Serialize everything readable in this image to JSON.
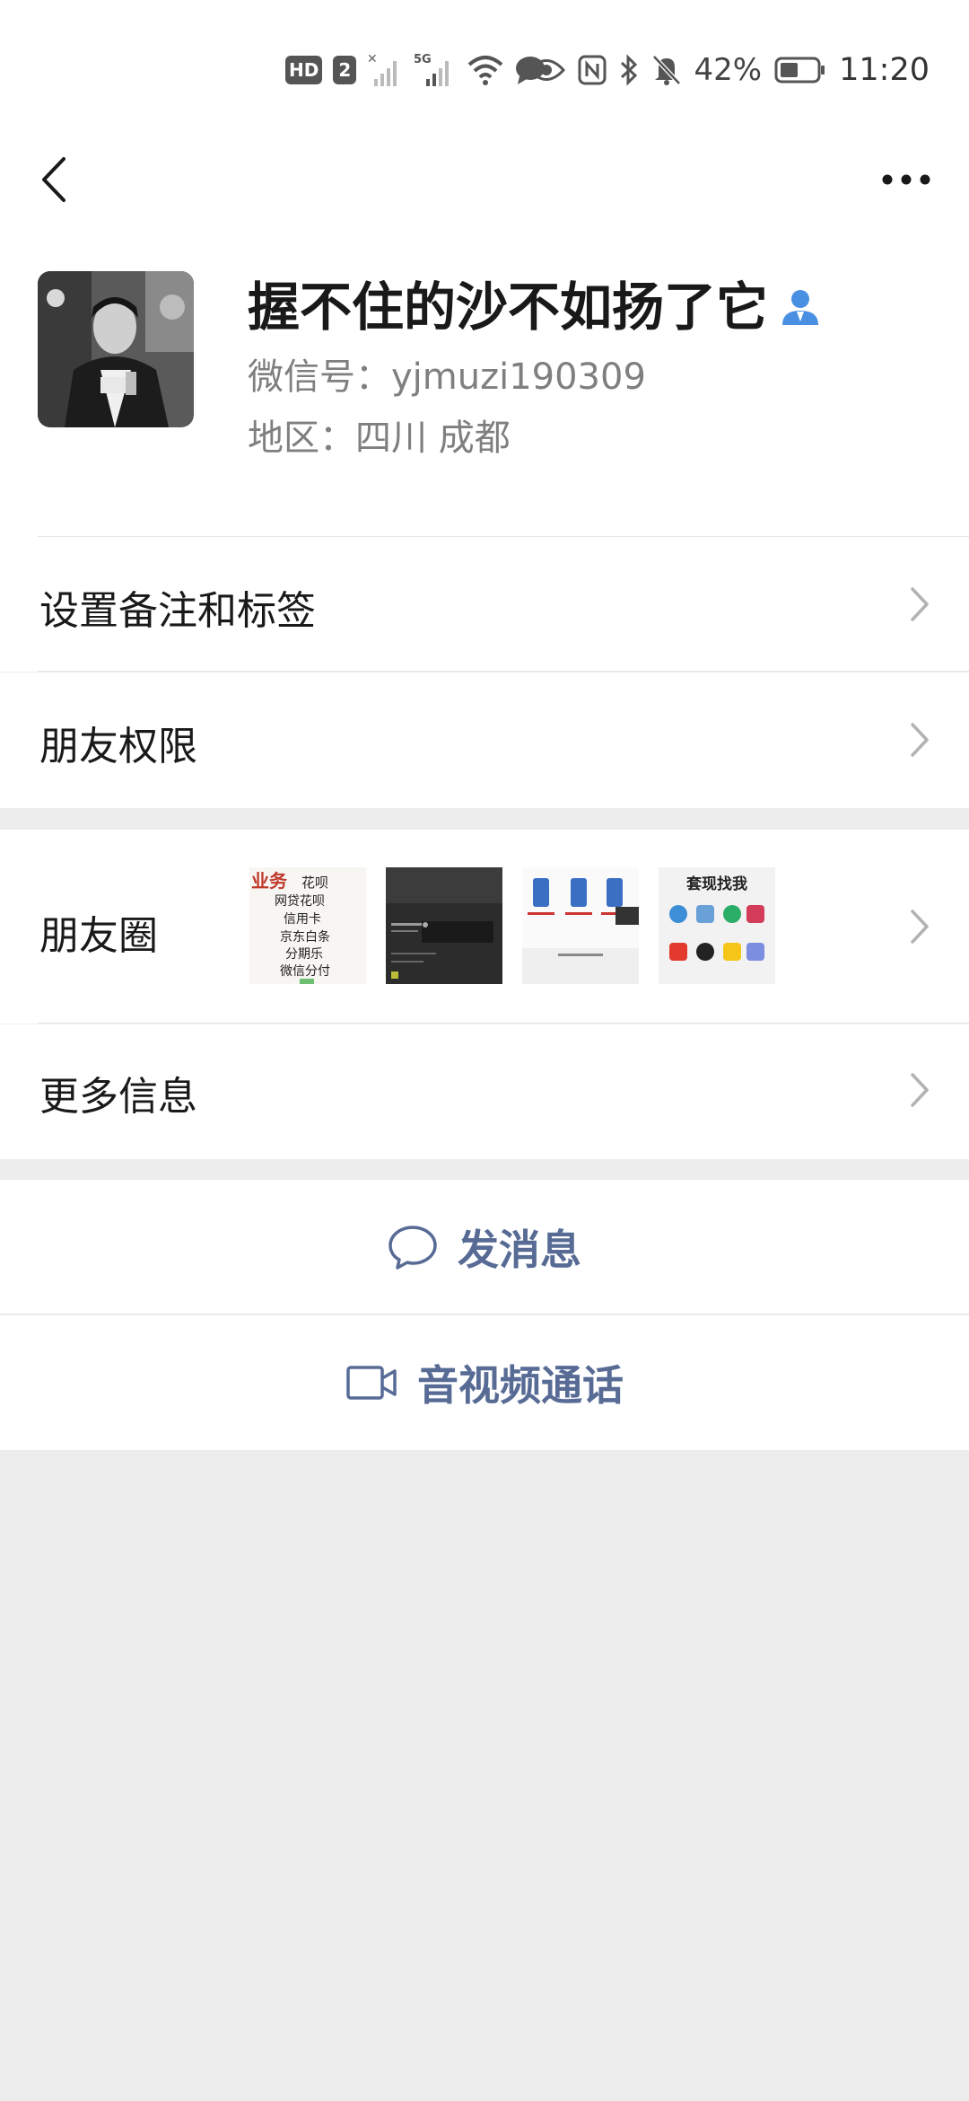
{
  "status_bar": {
    "hd": "HD",
    "sim": "2",
    "network": "5G",
    "battery": "42%",
    "time": "11:20",
    "icons": [
      "hd-icon",
      "signal-x-icon",
      "signal-5g-icon",
      "wifi-icon",
      "chat-bubble-icon",
      "eye-icon",
      "nfc-icon",
      "bluetooth-icon",
      "mute-bell-icon",
      "battery-icon"
    ]
  },
  "header": {
    "back_icon": "chevron-left-icon",
    "more_icon": "more-dots-icon"
  },
  "profile": {
    "nickname": "握不住的沙不如扬了它",
    "wechat_id": "微信号：yjmuzi190309",
    "region": "地区：四川  成都",
    "badge_icon": "person-icon"
  },
  "menu": {
    "remark_tags": "设置备注和标签",
    "friend_permissions": "朋友权限",
    "moments": "朋友圈",
    "more_info": "更多信息"
  },
  "moments_thumbs": {
    "thumb1_lines": [
      "业务",
      "花呗",
      "网贷花呗",
      "信用卡",
      "京东白条",
      "分期乐",
      "微信分付"
    ],
    "thumb4_title": "套现找我"
  },
  "actions": {
    "send_message": "发消息",
    "av_call": "音视频通话"
  },
  "colors": {
    "link_blue": "#576b95",
    "badge_blue": "#4a90e2",
    "background": "#ededed"
  }
}
